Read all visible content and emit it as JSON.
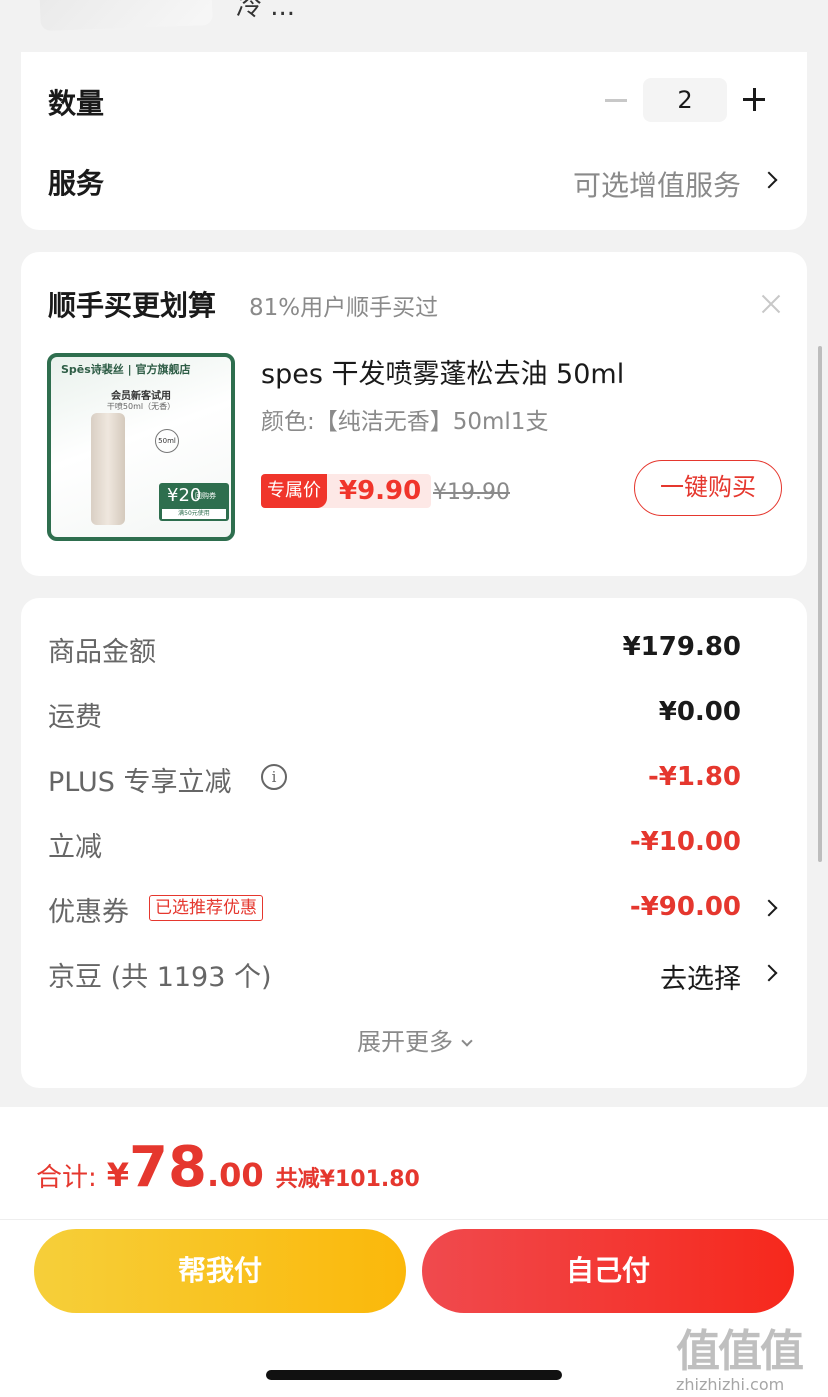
{
  "top_peek": {
    "text": "冷 ..."
  },
  "order": {
    "quantity_label": "数量",
    "quantity_value": "2",
    "service_label": "服务",
    "service_value": "可选增值服务"
  },
  "upsell": {
    "title": "顺手买更划算",
    "subtitle": "81%用户顺手买过",
    "product": {
      "image_brand": "Spēs诗裴丝 | 官方旗舰店",
      "image_member": "会员新客试用",
      "image_size": "干喷50ml（无香）",
      "image_50ml": "50ml",
      "image_coupon_amount": "¥20",
      "image_coupon_tag": "回购券",
      "image_coupon_cond": "满50元使用",
      "name": "spes 干发喷雾蓬松去油 50ml",
      "spec": "颜色:【纯洁无香】50ml1支",
      "badge": "专属价",
      "price": "¥9.90",
      "original_price": "¥19.90",
      "buy_label": "一键购买"
    }
  },
  "summary": {
    "rows": [
      {
        "label": "商品金额",
        "value": "¥179.80"
      },
      {
        "label": "运费",
        "value": "¥0.00"
      },
      {
        "label": "PLUS 专享立减",
        "value": "-¥1.80"
      },
      {
        "label": "立减",
        "value": "-¥10.00"
      },
      {
        "label": "优惠券",
        "tag": "已选推荐优惠",
        "value": "-¥90.00"
      },
      {
        "label": "京豆 (共 1193 个)",
        "value": "去选择"
      }
    ],
    "expand_label": "展开更多"
  },
  "footer": {
    "total_label": "合计:",
    "total_yen": "¥",
    "total_int": "78",
    "total_dec": ".00",
    "saved": "共减¥101.80",
    "help_pay": "帮我付",
    "self_pay": "自己付"
  },
  "watermark": {
    "glyphs": "值值值",
    "url": "zhizhizhi.com"
  },
  "colors": {
    "accent_red": "#e5372e",
    "help_yellow": "#fbc02d",
    "self_red": "#f23a35"
  }
}
